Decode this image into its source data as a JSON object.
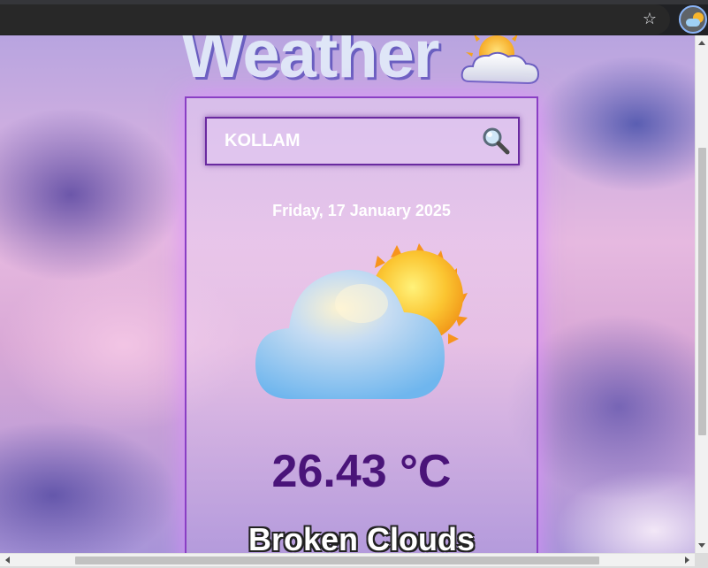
{
  "browser": {
    "bookmark_icon": "star-icon",
    "extension_icon": "weather-extension-icon"
  },
  "page": {
    "title": "Weather",
    "title_emoji": "sun-behind-cloud-icon"
  },
  "search": {
    "value": "KOLLAM",
    "placeholder": "",
    "icon": "magnifier-icon"
  },
  "weather": {
    "date": "Friday, 17 January 2025",
    "icon": "sun-behind-cloud-icon",
    "temperature": "26.43 °C",
    "condition": "Broken Clouds"
  },
  "colors": {
    "card_border": "#8a3fc4",
    "temperature_text": "#4a1479",
    "title_text": "#dfe6f7"
  }
}
